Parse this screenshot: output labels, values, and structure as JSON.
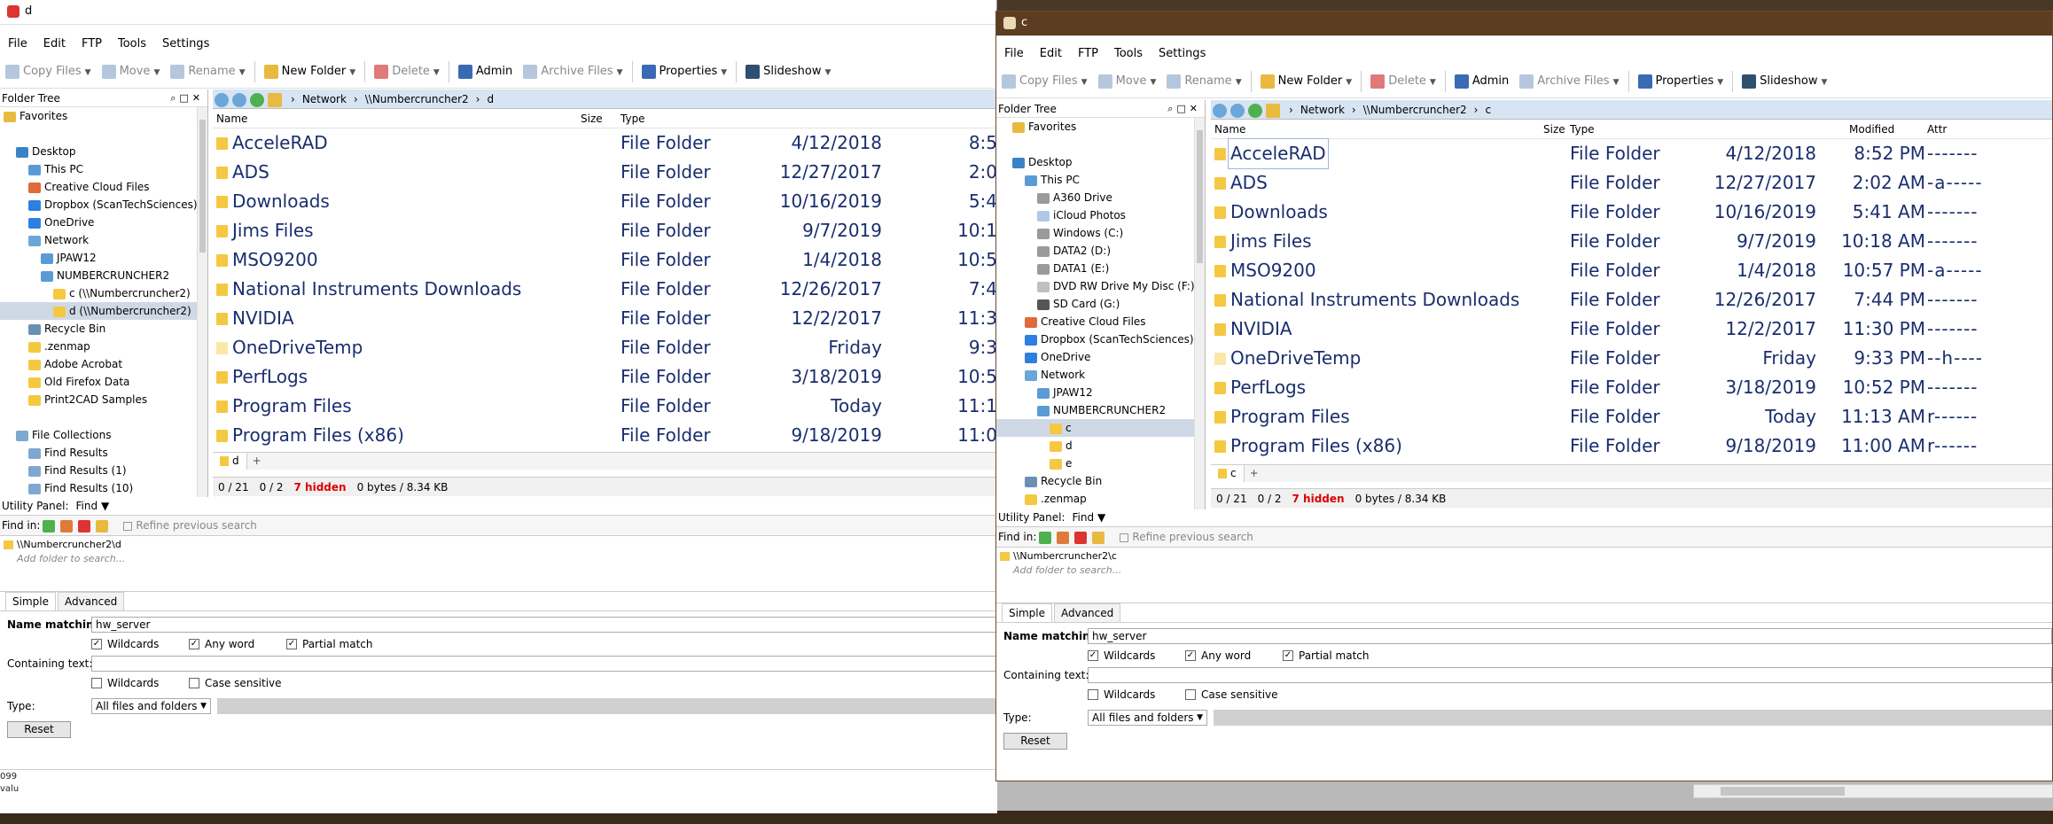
{
  "left_window": {
    "title": "d",
    "menu": [
      "File",
      "Edit",
      "FTP",
      "Tools",
      "Settings"
    ],
    "toolbar": [
      "Copy Files",
      "Move",
      "Rename",
      "New Folder",
      "Delete",
      "Admin",
      "Archive Files",
      "Properties",
      "Slideshow"
    ],
    "folder_tree_title": "Folder Tree",
    "tree": [
      {
        "label": "Favorites",
        "indent": 0,
        "icon": "star-icon"
      },
      {
        "label": "",
        "indent": 0,
        "icon": ""
      },
      {
        "label": "Desktop",
        "indent": 1,
        "icon": "desktop-icon"
      },
      {
        "label": "This PC",
        "indent": 2,
        "icon": "computer-icon"
      },
      {
        "label": "Creative Cloud Files",
        "indent": 2,
        "icon": "cloud-folder-icon"
      },
      {
        "label": "Dropbox (ScanTechSciences)",
        "indent": 2,
        "icon": "dropbox-icon"
      },
      {
        "label": "OneDrive",
        "indent": 2,
        "icon": "onedrive-icon"
      },
      {
        "label": "Network",
        "indent": 2,
        "icon": "network-icon"
      },
      {
        "label": "JPAW12",
        "indent": 3,
        "icon": "computer-icon"
      },
      {
        "label": "NUMBERCRUNCHER2",
        "indent": 3,
        "icon": "computer-icon"
      },
      {
        "label": "c (\\\\Numbercruncher2)",
        "indent": 4,
        "icon": "share-folder-icon"
      },
      {
        "label": "d (\\\\Numbercruncher2)",
        "indent": 4,
        "icon": "share-folder-icon",
        "selected": true
      },
      {
        "label": "Recycle Bin",
        "indent": 2,
        "icon": "recycle-bin-icon"
      },
      {
        "label": ".zenmap",
        "indent": 2,
        "icon": "folder-icon"
      },
      {
        "label": "Adobe Acrobat",
        "indent": 2,
        "icon": "folder-icon"
      },
      {
        "label": "Old Firefox Data",
        "indent": 2,
        "icon": "folder-icon"
      },
      {
        "label": "Print2CAD Samples",
        "indent": 2,
        "icon": "folder-icon"
      },
      {
        "label": "",
        "indent": 0,
        "icon": ""
      },
      {
        "label": "File Collections",
        "indent": 1,
        "icon": "collection-icon"
      },
      {
        "label": "Find Results",
        "indent": 2,
        "icon": "collection-icon"
      },
      {
        "label": "Find Results (1)",
        "indent": 2,
        "icon": "collection-icon"
      },
      {
        "label": "Find Results (10)",
        "indent": 2,
        "icon": "collection-icon"
      }
    ],
    "path": [
      "Network",
      "\\\\Numbercruncher2",
      "d"
    ],
    "columns": [
      "Name",
      "Size",
      "Type"
    ],
    "files": [
      {
        "name": "AcceleRAD",
        "type": "File Folder",
        "date": "4/12/2018",
        "time": "8:5"
      },
      {
        "name": "ADS",
        "type": "File Folder",
        "date": "12/27/2017",
        "time": "2:0"
      },
      {
        "name": "Downloads",
        "type": "File Folder",
        "date": "10/16/2019",
        "time": "5:4"
      },
      {
        "name": "Jims Files",
        "type": "File Folder",
        "date": "9/7/2019",
        "time": "10:1"
      },
      {
        "name": "MSO9200",
        "type": "File Folder",
        "date": "1/4/2018",
        "time": "10:5"
      },
      {
        "name": "National Instruments Downloads",
        "type": "File Folder",
        "date": "12/26/2017",
        "time": "7:4"
      },
      {
        "name": "NVIDIA",
        "type": "File Folder",
        "date": "12/2/2017",
        "time": "11:3"
      },
      {
        "name": "OneDriveTemp",
        "type": "File Folder",
        "date": "Friday",
        "time": "9:3",
        "ghost": true
      },
      {
        "name": "PerfLogs",
        "type": "File Folder",
        "date": "3/18/2019",
        "time": "10:5"
      },
      {
        "name": "Program Files",
        "type": "File Folder",
        "date": "Today",
        "time": "11:1"
      },
      {
        "name": "Program Files (x86)",
        "type": "File Folder",
        "date": "9/18/2019",
        "time": "11:0"
      }
    ],
    "tab": "d",
    "status": {
      "count": "0 / 21",
      "sel": "0 / 2",
      "hidden": "7 hidden",
      "bytes": "0 bytes / 8.34 KB"
    },
    "utility": {
      "label": "Utility Panel:",
      "mode": "Find",
      "find_in": "Find in:",
      "refine": "Refine previous search",
      "folder": "\\\\Numbercruncher2\\d",
      "add_placeholder": "Add folder to search...",
      "tab_simple": "Simple",
      "tab_advanced": "Advanced",
      "name_matching": "Name matching:",
      "name_value": "hw_server",
      "wildcards": "Wildcards",
      "any_word": "Any word",
      "partial": "Partial match",
      "containing": "Containing text:",
      "wildcards2": "Wildcards",
      "case": "Case sensitive",
      "type_label": "Type:",
      "type_value": "All files and folders",
      "reset": "Reset"
    }
  },
  "right_window": {
    "title": "c",
    "menu": [
      "File",
      "Edit",
      "FTP",
      "Tools",
      "Settings"
    ],
    "toolbar": [
      "Copy Files",
      "Move",
      "Rename",
      "New Folder",
      "Delete",
      "Admin",
      "Archive Files",
      "Properties",
      "Slideshow"
    ],
    "folder_tree_title": "Folder Tree",
    "tree": [
      {
        "label": "Favorites",
        "indent": 1,
        "icon": "star-icon"
      },
      {
        "label": "",
        "indent": 0,
        "icon": ""
      },
      {
        "label": "Desktop",
        "indent": 1,
        "icon": "desktop-icon"
      },
      {
        "label": "This PC",
        "indent": 2,
        "icon": "computer-icon"
      },
      {
        "label": "A360 Drive",
        "indent": 3,
        "icon": "drive-icon"
      },
      {
        "label": "iCloud Photos",
        "indent": 3,
        "icon": "icloud-icon"
      },
      {
        "label": "Windows (C:)",
        "indent": 3,
        "icon": "drive-icon"
      },
      {
        "label": "DATA2 (D:)",
        "indent": 3,
        "icon": "drive-icon"
      },
      {
        "label": "DATA1 (E:)",
        "indent": 3,
        "icon": "drive-icon"
      },
      {
        "label": "DVD RW Drive My Disc (F:)",
        "indent": 3,
        "icon": "dvd-icon"
      },
      {
        "label": "SD Card (G:)",
        "indent": 3,
        "icon": "sd-card-icon"
      },
      {
        "label": "Creative Cloud Files",
        "indent": 2,
        "icon": "cloud-folder-icon"
      },
      {
        "label": "Dropbox (ScanTechSciences)",
        "indent": 2,
        "icon": "dropbox-icon"
      },
      {
        "label": "OneDrive",
        "indent": 2,
        "icon": "onedrive-icon"
      },
      {
        "label": "Network",
        "indent": 2,
        "icon": "network-icon"
      },
      {
        "label": "JPAW12",
        "indent": 3,
        "icon": "computer-icon"
      },
      {
        "label": "NUMBERCRUNCHER2",
        "indent": 3,
        "icon": "computer-icon"
      },
      {
        "label": "c",
        "indent": 4,
        "icon": "share-folder-icon",
        "selected": true
      },
      {
        "label": "d",
        "indent": 4,
        "icon": "share-folder-icon"
      },
      {
        "label": "e",
        "indent": 4,
        "icon": "share-folder-icon"
      },
      {
        "label": "Recycle Bin",
        "indent": 2,
        "icon": "recycle-bin-icon"
      },
      {
        "label": ".zenmap",
        "indent": 2,
        "icon": "folder-icon"
      }
    ],
    "path": [
      "Network",
      "\\\\Numbercruncher2",
      "c"
    ],
    "columns": [
      "Name",
      "Size",
      "Type",
      "Modified",
      "Attr"
    ],
    "files": [
      {
        "name": "AcceleRAD",
        "type": "File Folder",
        "date": "4/12/2018",
        "time": "8:52 PM",
        "attr": "-------",
        "hl": true
      },
      {
        "name": "ADS",
        "type": "File Folder",
        "date": "12/27/2017",
        "time": "2:02 AM",
        "attr": "-a-----"
      },
      {
        "name": "Downloads",
        "type": "File Folder",
        "date": "10/16/2019",
        "time": "5:41 AM",
        "attr": "-------"
      },
      {
        "name": "Jims Files",
        "type": "File Folder",
        "date": "9/7/2019",
        "time": "10:18 AM",
        "attr": "-------"
      },
      {
        "name": "MSO9200",
        "type": "File Folder",
        "date": "1/4/2018",
        "time": "10:57 PM",
        "attr": "-a-----"
      },
      {
        "name": "National Instruments Downloads",
        "type": "File Folder",
        "date": "12/26/2017",
        "time": "7:44 PM",
        "attr": "-------"
      },
      {
        "name": "NVIDIA",
        "type": "File Folder",
        "date": "12/2/2017",
        "time": "11:30 PM",
        "attr": "-------"
      },
      {
        "name": "OneDriveTemp",
        "type": "File Folder",
        "date": "Friday",
        "time": "9:33 PM",
        "attr": "--h----",
        "ghost": true
      },
      {
        "name": "PerfLogs",
        "type": "File Folder",
        "date": "3/18/2019",
        "time": "10:52 PM",
        "attr": "-------"
      },
      {
        "name": "Program Files",
        "type": "File Folder",
        "date": "Today",
        "time": "11:13 AM",
        "attr": "r------"
      },
      {
        "name": "Program Files (x86)",
        "type": "File Folder",
        "date": "9/18/2019",
        "time": "11:00 AM",
        "attr": "r------"
      }
    ],
    "tab": "c",
    "status": {
      "count": "0 / 21",
      "sel": "0 / 2",
      "hidden": "7 hidden",
      "bytes": "0 bytes / 8.34 KB"
    },
    "utility": {
      "label": "Utility Panel:",
      "mode": "Find",
      "find_in": "Find in:",
      "refine": "Refine previous search",
      "folder": "\\\\Numbercruncher2\\c",
      "add_placeholder": "Add folder to search...",
      "tab_simple": "Simple",
      "tab_advanced": "Advanced",
      "name_matching": "Name matching:",
      "name_value": "hw_server",
      "wildcards": "Wildcards",
      "any_word": "Any word",
      "partial": "Partial match",
      "containing": "Containing text:",
      "wildcards2": "Wildcards",
      "case": "Case sensitive",
      "type_label": "Type:",
      "type_value": "All files and folders",
      "reset": "Reset"
    }
  },
  "background": {
    "corner_text": [
      "099",
      "valu"
    ]
  },
  "colors": {
    "folder": "#f5c842",
    "file_text": "#1a2e6e",
    "hidden_status": "#dd0000",
    "address_bar": "#d7e4f3",
    "right_titlebar": "#5c3d22"
  }
}
